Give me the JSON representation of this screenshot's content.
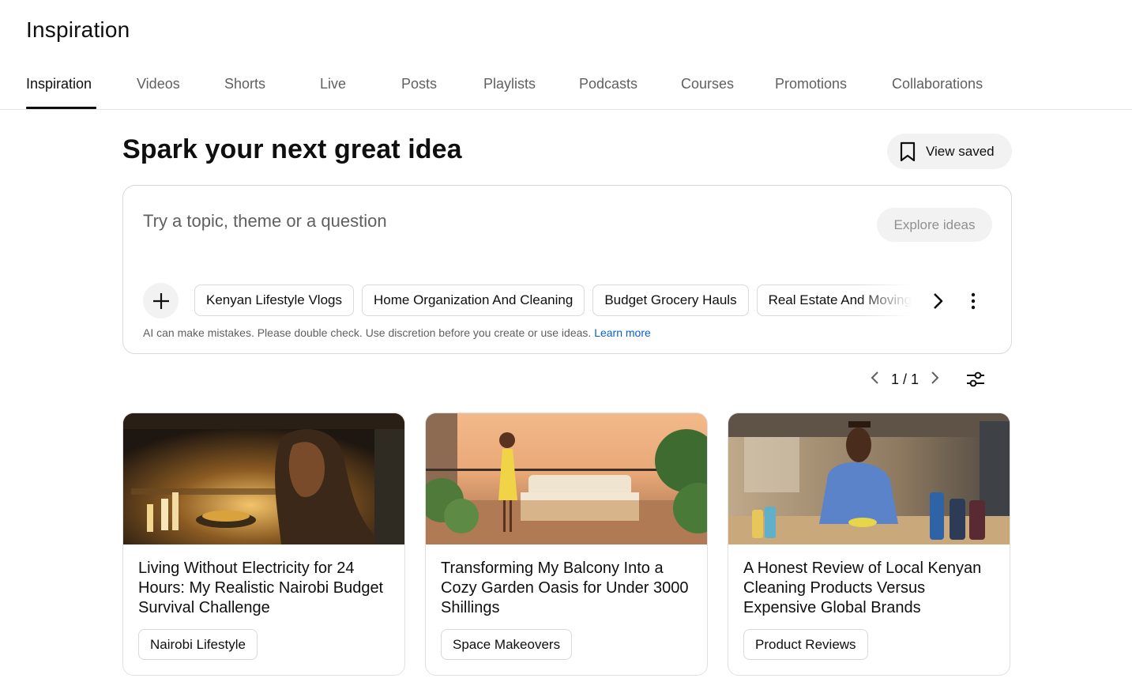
{
  "page": {
    "title": "Inspiration"
  },
  "tabs": [
    {
      "label": "Inspiration",
      "active": true
    },
    {
      "label": "Videos"
    },
    {
      "label": "Shorts"
    },
    {
      "label": "Live"
    },
    {
      "label": "Posts"
    },
    {
      "label": "Playlists"
    },
    {
      "label": "Podcasts"
    },
    {
      "label": "Courses"
    },
    {
      "label": "Promotions"
    },
    {
      "label": "Collaborations"
    }
  ],
  "hero": {
    "title": "Spark your next great idea",
    "view_saved_label": "View saved",
    "view_saved_icon": "bookmark-icon"
  },
  "search": {
    "placeholder": "Try a topic, theme or a question",
    "value": "",
    "explore_label": "Explore ideas",
    "chips": [
      "Kenyan Lifestyle Vlogs",
      "Home Organization And Cleaning",
      "Budget Grocery Hauls",
      "Real Estate And Moving"
    ],
    "disclaimer": "AI can make mistakes. Please double check. Use discretion before you create or use ideas.",
    "learn_more": "Learn more"
  },
  "pager": {
    "text": "1 / 1"
  },
  "cards": [
    {
      "title": "Living Without Electricity for 24 Hours: My Realistic Nairobi Budget Survival Challenge",
      "tag": "Nairobi Lifestyle"
    },
    {
      "title": "Transforming My Balcony Into a Cozy Garden Oasis for Under 3000 Shillings",
      "tag": "Space Makeovers"
    },
    {
      "title": "A Honest Review of Local Kenyan Cleaning Products Versus Expensive Global Brands",
      "tag": "Product Reviews"
    }
  ],
  "colors": {
    "link": "#065fd4",
    "muted": "#606060",
    "chip_border": "#d9d9d9",
    "button_bg": "#f2f2f2"
  }
}
